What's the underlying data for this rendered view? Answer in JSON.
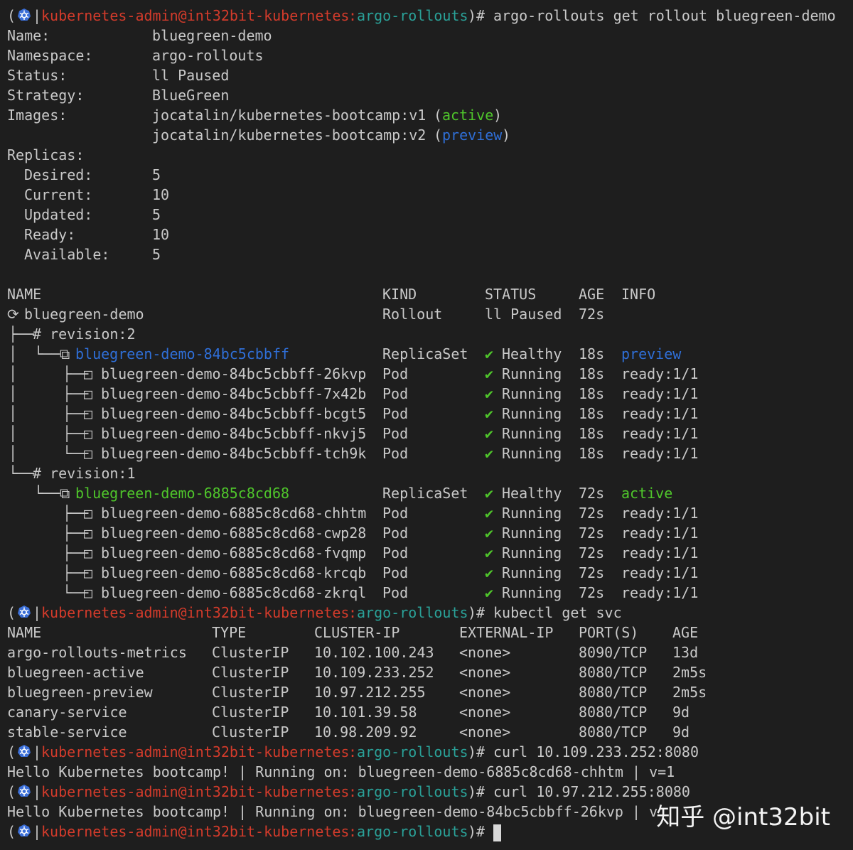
{
  "prompt": {
    "k8s_icon": "kubernetes-icon",
    "open": "(",
    "sep": "|",
    "context": "kubernetes-admin@int32bit-kubernetes",
    "colon": ":",
    "namespace": "argo-rollouts",
    "close": ")#"
  },
  "commands": {
    "get_rollout": "argo-rollouts get rollout bluegreen-demo",
    "get_svc": "kubectl get svc",
    "curl_active": "curl 10.109.233.252:8080",
    "curl_preview": "curl 10.97.212.255:8080"
  },
  "rollout_summary": {
    "name_label": "Name:",
    "name": "bluegreen-demo",
    "namespace_label": "Namespace:",
    "namespace": "argo-rollouts",
    "status_label": "Status:",
    "status": "ll Paused",
    "strategy_label": "Strategy:",
    "strategy": "BlueGreen",
    "images_label": "Images:",
    "images": [
      {
        "image": "jocatalin/kubernetes-bootcamp:v1",
        "tag": "active"
      },
      {
        "image": "jocatalin/kubernetes-bootcamp:v2",
        "tag": "preview"
      }
    ],
    "replicas_label": "Replicas:",
    "replicas": [
      {
        "label": "Desired:",
        "value": "5"
      },
      {
        "label": "Current:",
        "value": "10"
      },
      {
        "label": "Updated:",
        "value": "5"
      },
      {
        "label": "Ready:",
        "value": "10"
      },
      {
        "label": "Available:",
        "value": "5"
      }
    ]
  },
  "tree": {
    "headers": {
      "name": "NAME",
      "kind": "KIND",
      "status": "STATUS",
      "age": "AGE",
      "info": "INFO"
    },
    "root": {
      "name": "bluegreen-demo",
      "kind": "Rollout",
      "status": "ll Paused",
      "age": "72s"
    },
    "revisions": [
      {
        "label": "# revision:2",
        "replicaset": {
          "name": "bluegreen-demo-84bc5cbbff",
          "kind": "ReplicaSet",
          "status": "Healthy",
          "age": "18s",
          "info": "preview"
        },
        "pods": [
          {
            "name": "bluegreen-demo-84bc5cbbff-26kvp",
            "kind": "Pod",
            "status": "Running",
            "age": "18s",
            "info": "ready:1/1"
          },
          {
            "name": "bluegreen-demo-84bc5cbbff-7x42b",
            "kind": "Pod",
            "status": "Running",
            "age": "18s",
            "info": "ready:1/1"
          },
          {
            "name": "bluegreen-demo-84bc5cbbff-bcgt5",
            "kind": "Pod",
            "status": "Running",
            "age": "18s",
            "info": "ready:1/1"
          },
          {
            "name": "bluegreen-demo-84bc5cbbff-nkvj5",
            "kind": "Pod",
            "status": "Running",
            "age": "18s",
            "info": "ready:1/1"
          },
          {
            "name": "bluegreen-demo-84bc5cbbff-tch9k",
            "kind": "Pod",
            "status": "Running",
            "age": "18s",
            "info": "ready:1/1"
          }
        ]
      },
      {
        "label": "# revision:1",
        "replicaset": {
          "name": "bluegreen-demo-6885c8cd68",
          "kind": "ReplicaSet",
          "status": "Healthy",
          "age": "72s",
          "info": "active"
        },
        "pods": [
          {
            "name": "bluegreen-demo-6885c8cd68-chhtm",
            "kind": "Pod",
            "status": "Running",
            "age": "72s",
            "info": "ready:1/1"
          },
          {
            "name": "bluegreen-demo-6885c8cd68-cwp28",
            "kind": "Pod",
            "status": "Running",
            "age": "72s",
            "info": "ready:1/1"
          },
          {
            "name": "bluegreen-demo-6885c8cd68-fvqmp",
            "kind": "Pod",
            "status": "Running",
            "age": "72s",
            "info": "ready:1/1"
          },
          {
            "name": "bluegreen-demo-6885c8cd68-krcqb",
            "kind": "Pod",
            "status": "Running",
            "age": "72s",
            "info": "ready:1/1"
          },
          {
            "name": "bluegreen-demo-6885c8cd68-zkrql",
            "kind": "Pod",
            "status": "Running",
            "age": "72s",
            "info": "ready:1/1"
          }
        ]
      }
    ]
  },
  "services": {
    "headers": {
      "name": "NAME",
      "type": "TYPE",
      "cluster_ip": "CLUSTER-IP",
      "external_ip": "EXTERNAL-IP",
      "ports": "PORT(S)",
      "age": "AGE"
    },
    "rows": [
      {
        "name": "argo-rollouts-metrics",
        "type": "ClusterIP",
        "cluster_ip": "10.102.100.243",
        "external_ip": "<none>",
        "ports": "8090/TCP",
        "age": "13d"
      },
      {
        "name": "bluegreen-active",
        "type": "ClusterIP",
        "cluster_ip": "10.109.233.252",
        "external_ip": "<none>",
        "ports": "8080/TCP",
        "age": "2m5s"
      },
      {
        "name": "bluegreen-preview",
        "type": "ClusterIP",
        "cluster_ip": "10.97.212.255",
        "external_ip": "<none>",
        "ports": "8080/TCP",
        "age": "2m5s"
      },
      {
        "name": "canary-service",
        "type": "ClusterIP",
        "cluster_ip": "10.101.39.58",
        "external_ip": "<none>",
        "ports": "8080/TCP",
        "age": "9d"
      },
      {
        "name": "stable-service",
        "type": "ClusterIP",
        "cluster_ip": "10.98.209.92",
        "external_ip": "<none>",
        "ports": "8080/TCP",
        "age": "9d"
      }
    ]
  },
  "curl_outputs": {
    "active": "Hello Kubernetes bootcamp! | Running on: bluegreen-demo-6885c8cd68-chhtm | v=1",
    "preview": "Hello Kubernetes bootcamp! | Running on: bluegreen-demo-84bc5cbbff-26kvp | v"
  },
  "watermark": "知乎 @int32bit",
  "colors": {
    "background": "#1e1e1e",
    "text": "#c9c9c9",
    "context_red": "#d33b2b",
    "namespace_teal": "#2aa198",
    "active_green": "#4fc62b",
    "preview_blue": "#2f6fd8"
  }
}
